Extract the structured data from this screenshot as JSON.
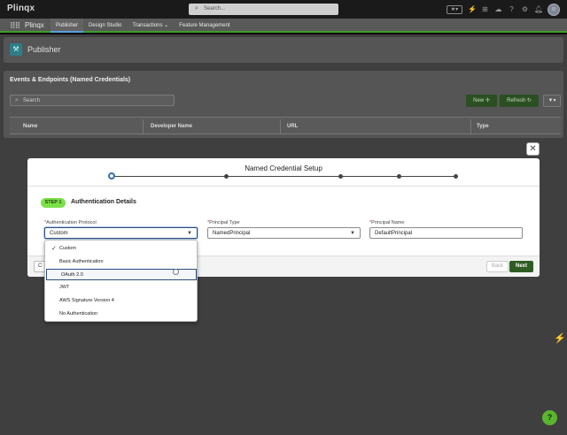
{
  "header": {
    "logo": "Plinqx",
    "search_placeholder": "Search...",
    "icons": [
      "favorites-icon",
      "lightning-icon",
      "add-icon",
      "help-icon",
      "setup-icon",
      "notifications-icon",
      "avatar-icon"
    ]
  },
  "nav": {
    "app_name": "Plinqx",
    "tabs": [
      {
        "label": "Publisher",
        "active": true
      },
      {
        "label": "Design Studio",
        "active": false
      },
      {
        "label": "Transactions",
        "active": false,
        "has_menu": true
      },
      {
        "label": "Feature Management",
        "active": false
      }
    ]
  },
  "page": {
    "title": "Publisher",
    "card_title": "Events & Endpoints (Named Credentials)",
    "search_placeholder": "Search",
    "new_label": "New",
    "refresh_label": "Refresh",
    "columns": [
      "Name",
      "Developer Name",
      "URL",
      "Type"
    ]
  },
  "modal": {
    "title": "Named Credential Setup",
    "step_badge": "STEP 1",
    "step_title": "Authentication Details",
    "progress_steps": 5,
    "current_step": 1,
    "fields": {
      "auth_protocol": {
        "label": "Authentication Protocol",
        "value": "Custom",
        "required": true
      },
      "principal_type": {
        "label": "Principal Type",
        "value": "NamedPrincipal",
        "required": true
      },
      "principal_name": {
        "label": "Principal Name",
        "value": "DefaultPrincipal",
        "required": true
      }
    },
    "cancel_label": "C",
    "back_label": "Back",
    "next_label": "Next"
  },
  "dropdown": {
    "options": [
      {
        "label": "Custom",
        "selected": true
      },
      {
        "label": "Basic Authentication",
        "selected": false
      },
      {
        "label": "OAuth 2.0",
        "selected": false,
        "hovered": true
      },
      {
        "label": "JWT",
        "selected": false
      },
      {
        "label": "AWS Signature Version 4",
        "selected": false
      },
      {
        "label": "No Authentication",
        "selected": false
      }
    ]
  },
  "colors": {
    "brand_green": "#2f5c22",
    "badge_green": "#7ce04a",
    "focus_blue": "#2a4d7f"
  }
}
